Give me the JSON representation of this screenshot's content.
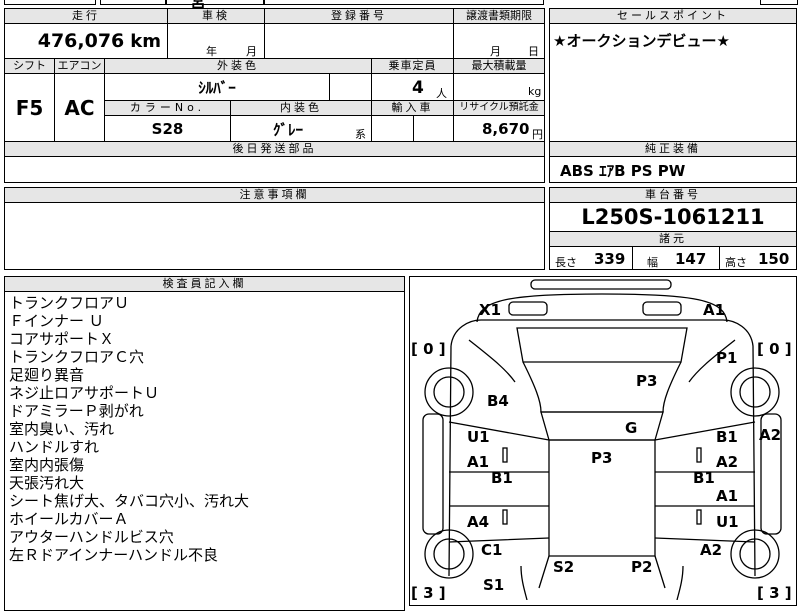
{
  "top_fragment": "宮",
  "labels": {
    "mileage": "走行",
    "inspection": "車検",
    "registration": "登録番号",
    "transfer_deadline": "譲渡書類期限",
    "sales_point": "セールスポイント",
    "shift": "シフト",
    "aircon": "エアコン",
    "exterior_color": "外装色",
    "capacity": "乗車定員",
    "max_load": "最大積載量",
    "color_no": "カラーNo.",
    "interior_color": "内装色",
    "import_car": "輸入車",
    "recycle_fee": "リサイクル預託金",
    "later_parts": "後日発送部品",
    "genuine_equipment": "純正装備",
    "notes": "注意事項欄",
    "chassis_number": "車台番号",
    "dimensions": "諸元",
    "inspector_notes": "検査員記入欄"
  },
  "vehicle": {
    "mileage": "476,076",
    "mileage_unit": "km",
    "inspection_year_unit": "年",
    "inspection_month_unit": "月",
    "transfer_month_unit": "月",
    "transfer_day_unit": "日",
    "shift": "F5",
    "aircon": "AC",
    "exterior_color": "ｼﾙﾊﾞｰ",
    "capacity": "4",
    "capacity_unit": "人",
    "load_unit": "kg",
    "color_no": "S28",
    "interior_color": "ｸﾞﾚｰ",
    "interior_color_suffix": "系",
    "recycle_fee": "8,670",
    "recycle_unit": "円",
    "sales_point": "★オークションデビュー★",
    "genuine_equipment": "ABS ｴｱB PS PW",
    "chassis_number": "L250S-1061211",
    "length_label": "長さ",
    "length": "339",
    "width_label": "幅",
    "width": "147",
    "height_label": "高さ",
    "height": "150"
  },
  "inspector_notes": [
    "トランクフロアＵ",
    "Ｆインナー Ｕ",
    "コアサポートＸ",
    "トランクフロアＣ穴",
    "足廻り異音",
    "ネジ止ロアサポートＵ",
    "ドアミラーＰ剥がれ",
    "室内臭い、汚れ",
    "ハンドルすれ",
    "室内内張傷",
    "天張汚れ大",
    "シート焦げ大、タバコ穴小、汚れ大",
    "ホイールカバーＡ",
    "アウターハンドルビス穴",
    "左Ｒドアインナーハンドル不良"
  ],
  "diagram": {
    "marks": {
      "x1": "X1",
      "a1_front_right": "A1",
      "p1": "P1",
      "p3_hood": "P3",
      "b4": "B4",
      "g": "G",
      "u1_left": "U1",
      "b1_right": "B1",
      "a2_right_edge": "A2",
      "a1_left": "A1",
      "a2_right_door": "A2",
      "b1_left": "B1",
      "b1_right_door": "B1",
      "p3_roof": "P3",
      "a1_right_rear": "A1",
      "a4": "A4",
      "u1_right_rear": "U1",
      "c1": "C1",
      "a2_rear_right": "A2",
      "s2": "S2",
      "p2": "P2",
      "s1": "S1"
    },
    "brackets": {
      "front_left": "[ 0 ]",
      "front_right": "[ 0 ]",
      "rear_left": "[ 3 ]",
      "rear_right": "[ 3 ]"
    }
  }
}
